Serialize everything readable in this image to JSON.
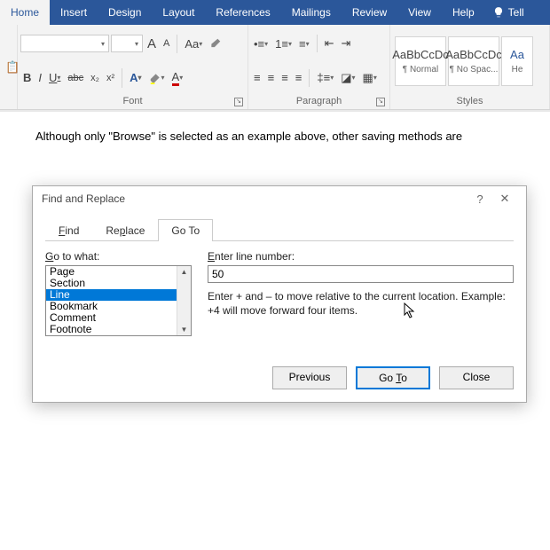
{
  "ribbon": {
    "tabs": [
      "Home",
      "Insert",
      "Design",
      "Layout",
      "References",
      "Mailings",
      "Review",
      "View",
      "Help"
    ],
    "tell_me": "Tell",
    "font_group": {
      "label": "Font",
      "font_name": "",
      "font_size": "",
      "grow": "A",
      "shrink": "A",
      "case": "Aa",
      "bold": "B",
      "italic": "I",
      "underline": "U",
      "strike": "abc",
      "sub": "x₂",
      "sup": "x²",
      "text_effects": "A",
      "highlight": "",
      "font_color": "A"
    },
    "paragraph_group": {
      "label": "Paragraph"
    },
    "styles_group": {
      "label": "Styles",
      "items": [
        {
          "preview": "AaBbCcDc",
          "name": "¶ Normal"
        },
        {
          "preview": "AaBbCcDc",
          "name": "¶ No Spac..."
        },
        {
          "preview": "Aa",
          "name": "He"
        }
      ]
    }
  },
  "document": {
    "body_text": "Although only \"Browse\" is selected as an example above, other saving methods are"
  },
  "dialog": {
    "title": "Find and Replace",
    "help": "?",
    "close": "✕",
    "tabs": {
      "find": "Find",
      "replace": "Replace",
      "goto": "Go To"
    },
    "goto": {
      "go_to_what_label_prefix": "G",
      "go_to_what_label_rest": "o to what:",
      "items": [
        "Page",
        "Section",
        "Line",
        "Bookmark",
        "Comment",
        "Footnote"
      ],
      "selected": "Line",
      "enter_label_prefix": "E",
      "enter_label_rest": "nter line number:",
      "value": "50",
      "hint": "Enter + and – to move relative to the current location. Example: +4 will move forward four items."
    },
    "buttons": {
      "previous": "Previous",
      "goto_pre": "Go ",
      "goto_u": "T",
      "goto_post": "o",
      "close": "Close"
    }
  }
}
